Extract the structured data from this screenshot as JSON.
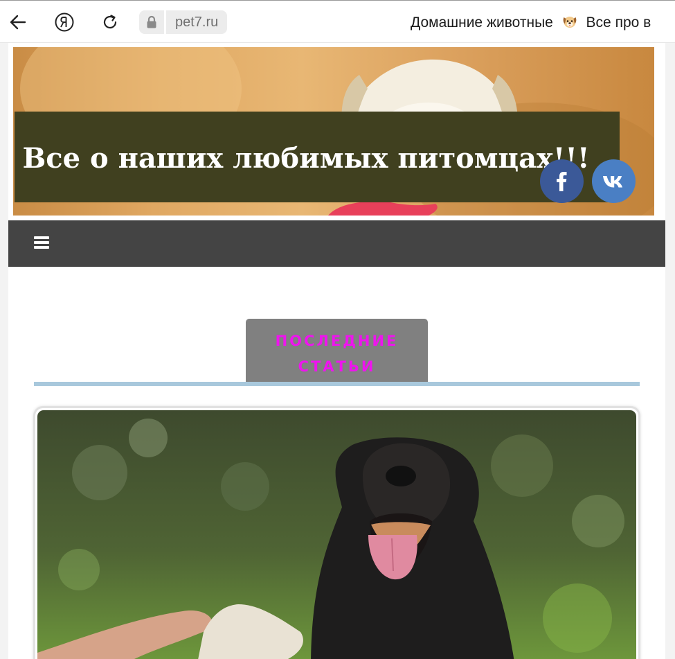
{
  "browser": {
    "url": "pet7.ru",
    "tab_title": "Домашние животные",
    "tab_title_suffix": "Все про в"
  },
  "header": {
    "site_title": "Все о наших любимых питомцах!!!"
  },
  "social": {
    "facebook_glyph": "f",
    "vk_glyph": "vk"
  },
  "section": {
    "title": "ПОСЛЕДНИЕ СТАТЬИ"
  },
  "colors": {
    "title_box": "#40401f",
    "menu_bar": "#444444",
    "section_tab": "#808080",
    "section_tab_text": "#ee14ee",
    "section_rule": "#a8c8dc",
    "facebook": "#3b5998",
    "vk": "#4a7fc4"
  },
  "icons": {
    "back": "arrow-left-icon",
    "yandex": "yandex-logo-icon",
    "reload": "reload-icon",
    "lock": "lock-icon",
    "tab_emoji": "dog-face-emoji-icon",
    "menu": "hamburger-menu-icon",
    "facebook": "facebook-icon",
    "vk": "vk-icon"
  }
}
